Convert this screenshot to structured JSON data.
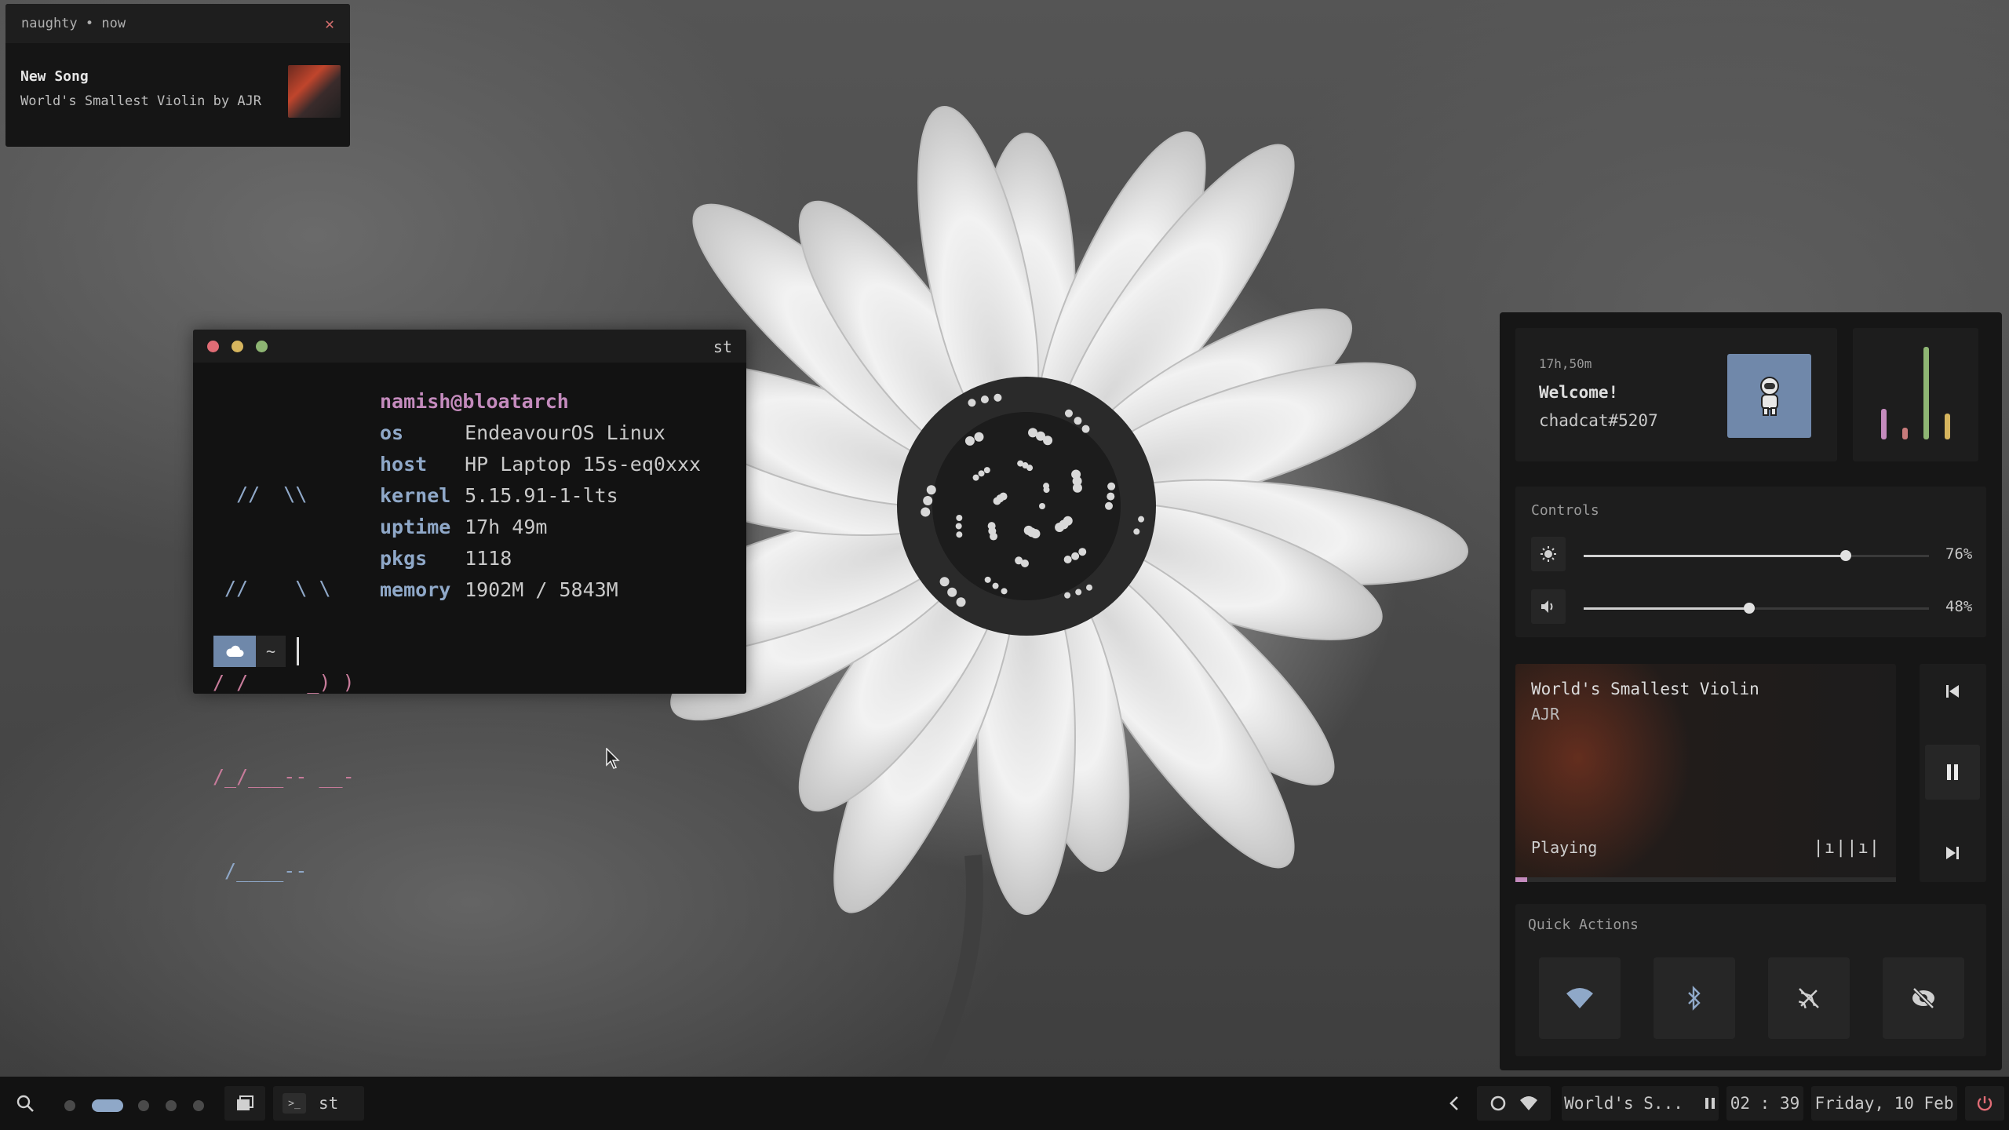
{
  "notification": {
    "app": "naughty • now",
    "title": "New Song",
    "body": "World's Smallest Violin by AJR",
    "close_icon": "close-icon"
  },
  "terminal": {
    "title": "st",
    "window_buttons": {
      "close": "#e06c75",
      "minimize": "#d6b55e",
      "maximize": "#8eb573"
    },
    "ascii_art": [
      {
        "text": "  //  \\\\",
        "color": "blue"
      },
      {
        "text": " //    \\ \\",
        "color": "blue"
      },
      {
        "text": "/ /     _) )",
        "color": "pink"
      },
      {
        "text": "/_/___-- __-",
        "color": "pink"
      },
      {
        "text": " /____--",
        "color": "blue"
      }
    ],
    "user_host": "namish@bloatarch",
    "fetch": [
      {
        "key": "os",
        "value": "EndeavourOS Linux"
      },
      {
        "key": "host",
        "value": "HP Laptop 15s-eq0xxx"
      },
      {
        "key": "kernel",
        "value": "5.15.91-1-lts"
      },
      {
        "key": "uptime",
        "value": "17h 49m"
      },
      {
        "key": "pkgs",
        "value": "1118"
      },
      {
        "key": "memory",
        "value": "1902M / 5843M"
      }
    ],
    "prompt": {
      "dir": "~",
      "icon": "cloud-icon"
    }
  },
  "dashboard": {
    "profile": {
      "uptime": "17h,50m",
      "greeting": "Welcome!",
      "handle": "chadcat#5207"
    },
    "bars": [
      {
        "value": 0.33,
        "color": "#c48bbd"
      },
      {
        "value": 0.13,
        "color": "#c77b7b"
      },
      {
        "value": 1.0,
        "color": "#8eb573"
      },
      {
        "value": 0.28,
        "color": "#d6b55e"
      }
    ],
    "controls": {
      "label": "Controls",
      "brightness": {
        "value": 76,
        "display": "76%"
      },
      "volume": {
        "value": 48,
        "display": "48%"
      }
    },
    "music": {
      "title": "World's Smallest Violin",
      "artist": "AJR",
      "status": "Playing",
      "progress": 0.03,
      "eq_icon": "|ı||ı|"
    },
    "quick_actions": {
      "label": "Quick Actions",
      "items": [
        "wifi-icon",
        "bluetooth-icon",
        "airplane-off-icon",
        "eye-off-icon"
      ]
    },
    "accent": "#8fa8c8"
  },
  "taskbar": {
    "active_app": "st",
    "music_short": "World's S...",
    "time": "02 : 39",
    "date": "Friday, 10 Feb"
  }
}
